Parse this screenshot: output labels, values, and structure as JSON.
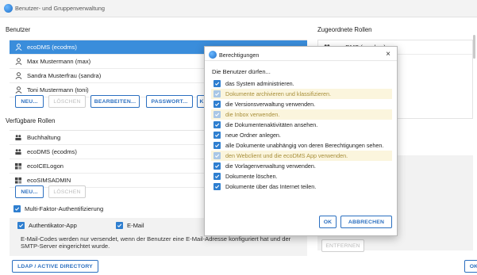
{
  "window": {
    "title": "Benutzer- und Gruppenverwaltung"
  },
  "users": {
    "heading": "Benutzer",
    "items": [
      {
        "label": "ecoDMS (ecodms)",
        "selected": true
      },
      {
        "label": "Max Mustermann (max)",
        "selected": false
      },
      {
        "label": "Sandra Musterfrau (sandra)",
        "selected": false
      },
      {
        "label": "Toni Mustermann (toni)",
        "selected": false
      }
    ],
    "buttons": {
      "new": "NEU...",
      "delete": "LÖSCHEN",
      "edit": "BEARBEITEN...",
      "password": "PASSWORT...",
      "extra": "K"
    }
  },
  "available_roles": {
    "heading": "Verfügbare Rollen",
    "items": [
      {
        "label": "Buchhaltung",
        "icon": "group-icon"
      },
      {
        "label": "ecoDMS (ecodms)",
        "icon": "group-icon"
      },
      {
        "label": "ecoICELogon",
        "icon": "role-icon"
      },
      {
        "label": "ecoSIMSADMIN",
        "icon": "role-icon"
      }
    ],
    "buttons": {
      "new": "NEU...",
      "delete": "LÖSCHEN"
    }
  },
  "mfa": {
    "label": "Multi-Faktor-Authentifizierung",
    "auth_app": "Authentikator-App",
    "email": "E-Mail",
    "note": "E-Mail-Codes werden nur versendet, wenn der Benutzer eine E-Mail-Adresse konfiguriert hat und der SMTP-Server eingerichtet wurde."
  },
  "ldap_button": "LDAP / ACTIVE DIRECTORY",
  "assigned_roles": {
    "heading": "Zugeordnete Rollen",
    "items": [
      {
        "label": "ecoDMS (ecodms)"
      }
    ],
    "remove_button": "ENTFERNEN"
  },
  "main_ok": "OK",
  "dialog": {
    "title": "Berechtigungen",
    "close": "×",
    "intro": "Die Benutzer dürfen...",
    "permissions": [
      {
        "label": "das System administrieren.",
        "checked": true,
        "disabled": false
      },
      {
        "label": "Dokumente archivieren und klassifizieren.",
        "checked": true,
        "disabled": true
      },
      {
        "label": "die Versionsverwaltung verwenden.",
        "checked": true,
        "disabled": false
      },
      {
        "label": "die Inbox verwenden.",
        "checked": true,
        "disabled": true
      },
      {
        "label": "die Dokumentenaktivitäten ansehen.",
        "checked": true,
        "disabled": false
      },
      {
        "label": "neue Ordner anlegen.",
        "checked": true,
        "disabled": false
      },
      {
        "label": "alle Dokumente unabhängig von deren Berechtigungen sehen.",
        "checked": true,
        "disabled": false
      },
      {
        "label": "den Webclient und die ecoDMS App verwenden.",
        "checked": true,
        "disabled": true
      },
      {
        "label": "die Vorlagenverwaltung verwenden.",
        "checked": true,
        "disabled": false
      },
      {
        "label": "Dokumente löschen.",
        "checked": true,
        "disabled": false
      },
      {
        "label": "Dokumente über das Internet teilen.",
        "checked": true,
        "disabled": false
      }
    ],
    "ok": "OK",
    "cancel": "ABBRECHEN"
  },
  "colors": {
    "accent": "#2f7fd0",
    "selection": "#3a8ddb",
    "disabled_highlight": "#fbf5dd"
  }
}
